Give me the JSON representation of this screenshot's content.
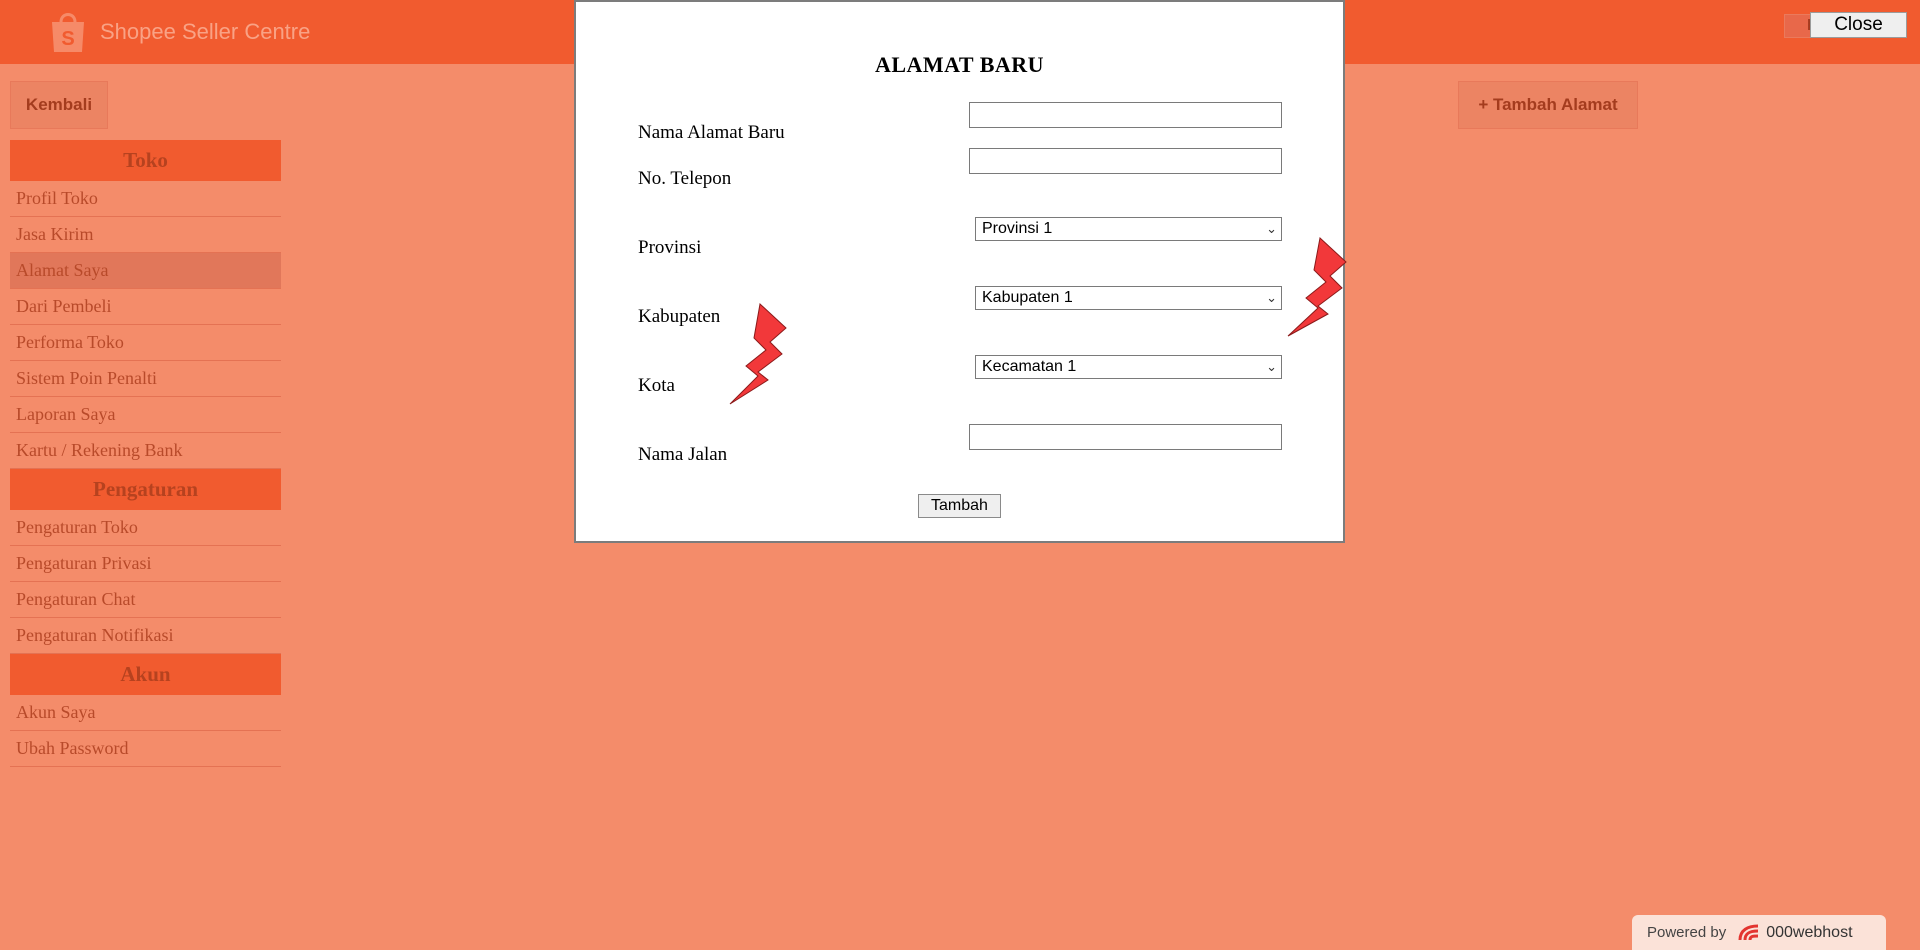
{
  "header": {
    "brand": "Shopee Seller Centre",
    "top_right_label": "L",
    "close_label": "Close"
  },
  "toolbar": {
    "back_label": "Kembali",
    "add_address_label": "+ Tambah Alamat"
  },
  "sidebar": {
    "sections": [
      {
        "title": "Toko",
        "items": [
          "Profil Toko",
          "Jasa Kirim",
          "Alamat Saya",
          "Dari Pembeli",
          "Performa Toko",
          "Sistem Poin Penalti",
          "Laporan Saya",
          "Kartu / Rekening Bank"
        ]
      },
      {
        "title": "Pengaturan",
        "items": [
          "Pengaturan Toko",
          "Pengaturan Privasi",
          "Pengaturan Chat",
          "Pengaturan Notifikasi"
        ]
      },
      {
        "title": "Akun",
        "items": [
          "Akun Saya",
          "Ubah Password"
        ]
      }
    ],
    "active_item": "Alamat Saya"
  },
  "modal": {
    "title": "ALAMAT BARU",
    "fields": {
      "nama_alamat_label": "Nama Alamat Baru",
      "nama_alamat_value": "",
      "telepon_label": "No. Telepon",
      "telepon_value": "",
      "provinsi_label": "Provinsi",
      "provinsi_selected": "Provinsi 1",
      "kabupaten_label": "Kabupaten",
      "kabupaten_selected": "Kabupaten 1",
      "kota_label": "Kota",
      "kota_selected": "Kecamatan 1",
      "jalan_label": "Nama Jalan",
      "jalan_value": ""
    },
    "submit_label": "Tambah"
  },
  "footer": {
    "powered_label": "Powered by",
    "host_name": "000webhost"
  },
  "colors": {
    "background": "#f48c6a",
    "topbar": "#f15b2f",
    "section_head": "#f15b2f",
    "bolt": "#f2383a"
  },
  "icons": [
    "shopee-bag-icon",
    "chevron-down-icon",
    "lightning-bolt-icon",
    "webhost-logo-icon"
  ]
}
